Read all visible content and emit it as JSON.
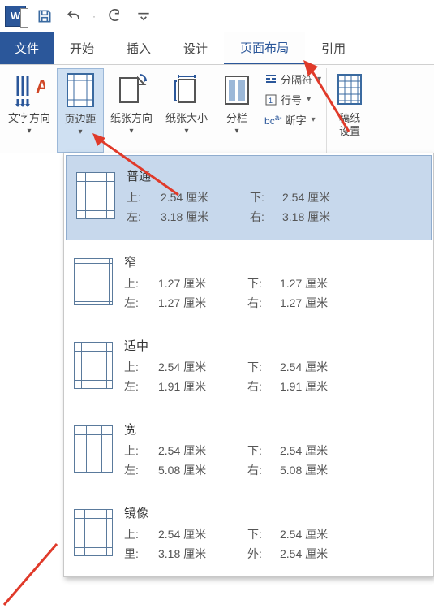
{
  "qat": {
    "word": "W"
  },
  "tabs": {
    "file": "文件",
    "home": "开始",
    "insert": "插入",
    "design": "设计",
    "layout": "页面布局",
    "references": "引用"
  },
  "ribbon": {
    "text_direction": "文字方向",
    "margins": "页边距",
    "orientation": "纸张方向",
    "size": "纸张大小",
    "columns": "分栏",
    "breaks": "分隔符",
    "line_numbers": "行号",
    "hyphenation": "断字",
    "stationery1": "稿纸",
    "stationery2": "设置"
  },
  "presets": [
    {
      "name": "普通",
      "icon": "normal",
      "top_label": "上:",
      "top_val": "2.54 厘米",
      "bottom_label": "下:",
      "bottom_val": "2.54 厘米",
      "left_label": "左:",
      "left_val": "3.18 厘米",
      "right_label": "右:",
      "right_val": "3.18 厘米",
      "selected": true
    },
    {
      "name": "窄",
      "icon": "narrow",
      "top_label": "上:",
      "top_val": "1.27 厘米",
      "bottom_label": "下:",
      "bottom_val": "1.27 厘米",
      "left_label": "左:",
      "left_val": "1.27 厘米",
      "right_label": "右:",
      "right_val": "1.27 厘米",
      "selected": false
    },
    {
      "name": "适中",
      "icon": "moderate",
      "top_label": "上:",
      "top_val": "2.54 厘米",
      "bottom_label": "下:",
      "bottom_val": "2.54 厘米",
      "left_label": "左:",
      "left_val": "1.91 厘米",
      "right_label": "右:",
      "right_val": "1.91 厘米",
      "selected": false
    },
    {
      "name": "宽",
      "icon": "wide",
      "top_label": "上:",
      "top_val": "2.54 厘米",
      "bottom_label": "下:",
      "bottom_val": "2.54 厘米",
      "left_label": "左:",
      "left_val": "5.08 厘米",
      "right_label": "右:",
      "right_val": "5.08 厘米",
      "selected": false
    },
    {
      "name": "镜像",
      "icon": "mirror",
      "top_label": "上:",
      "top_val": "2.54 厘米",
      "bottom_label": "下:",
      "bottom_val": "2.54 厘米",
      "left_label": "里:",
      "left_val": "3.18 厘米",
      "right_label": "外:",
      "right_val": "2.54 厘米",
      "selected": false
    }
  ]
}
